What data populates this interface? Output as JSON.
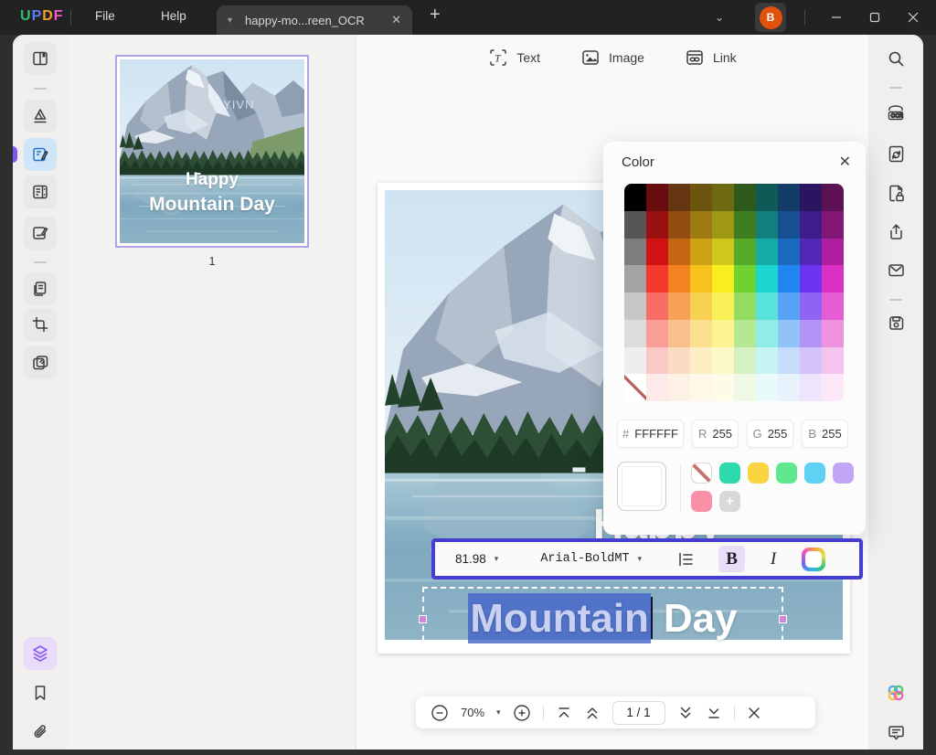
{
  "titlebar": {
    "logo_letters": [
      {
        "char": "U",
        "color": "#2fbf74"
      },
      {
        "char": "P",
        "color": "#5b7bfa"
      },
      {
        "char": "D",
        "color": "#f5a02d"
      },
      {
        "char": "F",
        "color": "#f25bc4"
      }
    ],
    "menu_file": "File",
    "menu_help": "Help",
    "tab_title": "happy-mo...reen_OCR",
    "avatar_initial": "B"
  },
  "edit_toolbar": {
    "text_label": "Text",
    "image_label": "Image",
    "link_label": "Link"
  },
  "thumbnail_panel": {
    "page_number": "1"
  },
  "doc": {
    "watermark": "YIVN",
    "thumb_line1": "Happy",
    "thumb_line2": "Mountain Day",
    "happy": "Happy",
    "selected_word": "Mountain",
    "rest_word": "Day"
  },
  "color_panel": {
    "title": "Color",
    "hex_label": "#",
    "hex_value": "FFFFFF",
    "rgb": [
      {
        "label": "R",
        "value": "255"
      },
      {
        "label": "G",
        "value": "255"
      },
      {
        "label": "B",
        "value": "255"
      }
    ],
    "grid_columns": [
      [
        "#000000",
        "#565656",
        "#7d7d7d",
        "#a3a3a3",
        "#c6c6c6",
        "#dcdcdc",
        "#eeeeee",
        "transparent"
      ],
      [
        "#670d0d",
        "#9a1010",
        "#cf1313",
        "#f43a2e",
        "#f76c64",
        "#fa9d97",
        "#fcc8c5",
        "#fdeae8"
      ],
      [
        "#663512",
        "#944d10",
        "#c56612",
        "#f48222",
        "#f6a155",
        "#f9c08d",
        "#fbdcc3",
        "#fdf1e6"
      ],
      [
        "#6d5510",
        "#9c7b12",
        "#cda215",
        "#f6c31d",
        "#f8d052",
        "#fae08e",
        "#fceec5",
        "#fdf8e7"
      ],
      [
        "#6e6a11",
        "#9e9815",
        "#cfc719",
        "#f8ed21",
        "#f9f057",
        "#fbf490",
        "#fcf9c7",
        "#fefce8"
      ],
      [
        "#2e591c",
        "#3f7e20",
        "#57a928",
        "#70d231",
        "#93dc61",
        "#b6e793",
        "#d5f1c2",
        "#eff9e5"
      ],
      [
        "#0e5a57",
        "#12807c",
        "#16aba6",
        "#1bd6cf",
        "#58e2dc",
        "#91ebe7",
        "#c5f4f2",
        "#e8fbfa"
      ],
      [
        "#133c69",
        "#175090",
        "#1c69c0",
        "#2186f2",
        "#58a3f5",
        "#91c3f8",
        "#c5ddfb",
        "#e8f2fd"
      ],
      [
        "#2b1561",
        "#3d1d89",
        "#5128b6",
        "#6b35ef",
        "#8f64f3",
        "#b294f7",
        "#d4c4fa",
        "#ece5fd"
      ],
      [
        "#5c1153",
        "#821778",
        "#ae1f9f",
        "#da2ec4",
        "#e65cd2",
        "#ee92e0",
        "#f5c4ee",
        "#fbe7f8"
      ]
    ],
    "current_color": "#FFFFFF",
    "presets": [
      "transparent",
      "#2ed9ac",
      "#fbd541",
      "#60e88f",
      "#5fd1f3",
      "#c1a5f6",
      "#fa8fa8"
    ],
    "add_label": "+"
  },
  "format_toolbar": {
    "font_size": "81.98",
    "font_name": "Arial-BoldMT",
    "bold_label": "B",
    "italic_label": "I"
  },
  "zoom_toolbar": {
    "zoom_level": "70%",
    "page_indicator": "1 / 1"
  }
}
